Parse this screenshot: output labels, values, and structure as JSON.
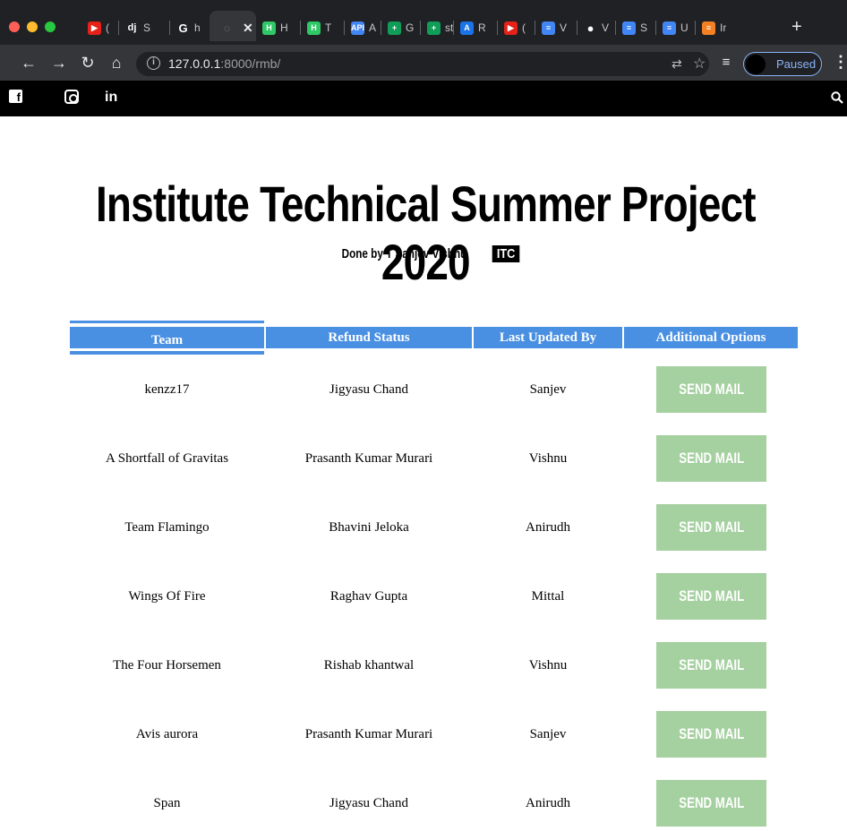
{
  "browser": {
    "tabs": [
      {
        "icon": "youtube-icon",
        "label": "(",
        "color": "#e62117"
      },
      {
        "icon": "django-icon",
        "label": "S",
        "color": "#0c4b33"
      },
      {
        "icon": "google-icon",
        "label": "h",
        "color": "#ffffff"
      },
      {
        "icon": "globe-icon",
        "label": "",
        "color": "#5f6368",
        "active": true
      },
      {
        "icon": "hackerrank-icon",
        "label": "H",
        "color": "#2ec866"
      },
      {
        "icon": "hackerrank-icon",
        "label": "T",
        "color": "#2ec866"
      },
      {
        "icon": "api-icon",
        "label": "A",
        "color": "#4285f4"
      },
      {
        "icon": "sheets-icon",
        "label": "G",
        "color": "#0f9d58"
      },
      {
        "icon": "sheets-icon",
        "label": "st",
        "color": "#0f9d58"
      },
      {
        "icon": "a-icon",
        "label": "R",
        "color": "#1a73e8"
      },
      {
        "icon": "youtube-icon",
        "label": "(",
        "color": "#e62117"
      },
      {
        "icon": "docs-icon",
        "label": "V",
        "color": "#4285f4"
      },
      {
        "icon": "github-icon",
        "label": "V",
        "color": "#ffffff"
      },
      {
        "icon": "docs-icon",
        "label": "S",
        "color": "#4285f4"
      },
      {
        "icon": "docs-icon",
        "label": "U",
        "color": "#4285f4"
      },
      {
        "icon": "stackoverflow-icon",
        "label": "Ir",
        "color": "#f48024"
      }
    ],
    "url_host": "127.0.0.1",
    "url_rest": ":8000/rmb/",
    "profile_label": "Paused"
  },
  "page": {
    "title": "Institute Technical Summer Project 2020",
    "byline": "Done by T Sanjev Vishnu",
    "badge": "ITC"
  },
  "table": {
    "headers": [
      "Team",
      "Refund Status",
      "Last Updated By",
      "Additional Options"
    ],
    "button_label": "SEND MAIL",
    "rows": [
      {
        "team": "kenzz17",
        "status": "Jigyasu Chand",
        "updated_by": "Sanjev"
      },
      {
        "team": "A Shortfall of Gravitas",
        "status": "Prasanth Kumar Murari",
        "updated_by": "Vishnu"
      },
      {
        "team": "Team Flamingo",
        "status": "Bhavini Jeloka",
        "updated_by": "Anirudh"
      },
      {
        "team": "Wings Of Fire",
        "status": "Raghav Gupta",
        "updated_by": "Mittal"
      },
      {
        "team": "The Four Horsemen",
        "status": "Rishab khantwal",
        "updated_by": "Vishnu"
      },
      {
        "team": "Avis aurora",
        "status": "Prasanth Kumar Murari",
        "updated_by": "Sanjev"
      },
      {
        "team": "Span",
        "status": "Jigyasu Chand",
        "updated_by": "Anirudh"
      }
    ]
  },
  "colors": {
    "header_blue": "#4a90e2",
    "button_green": "#a5d0a0"
  }
}
